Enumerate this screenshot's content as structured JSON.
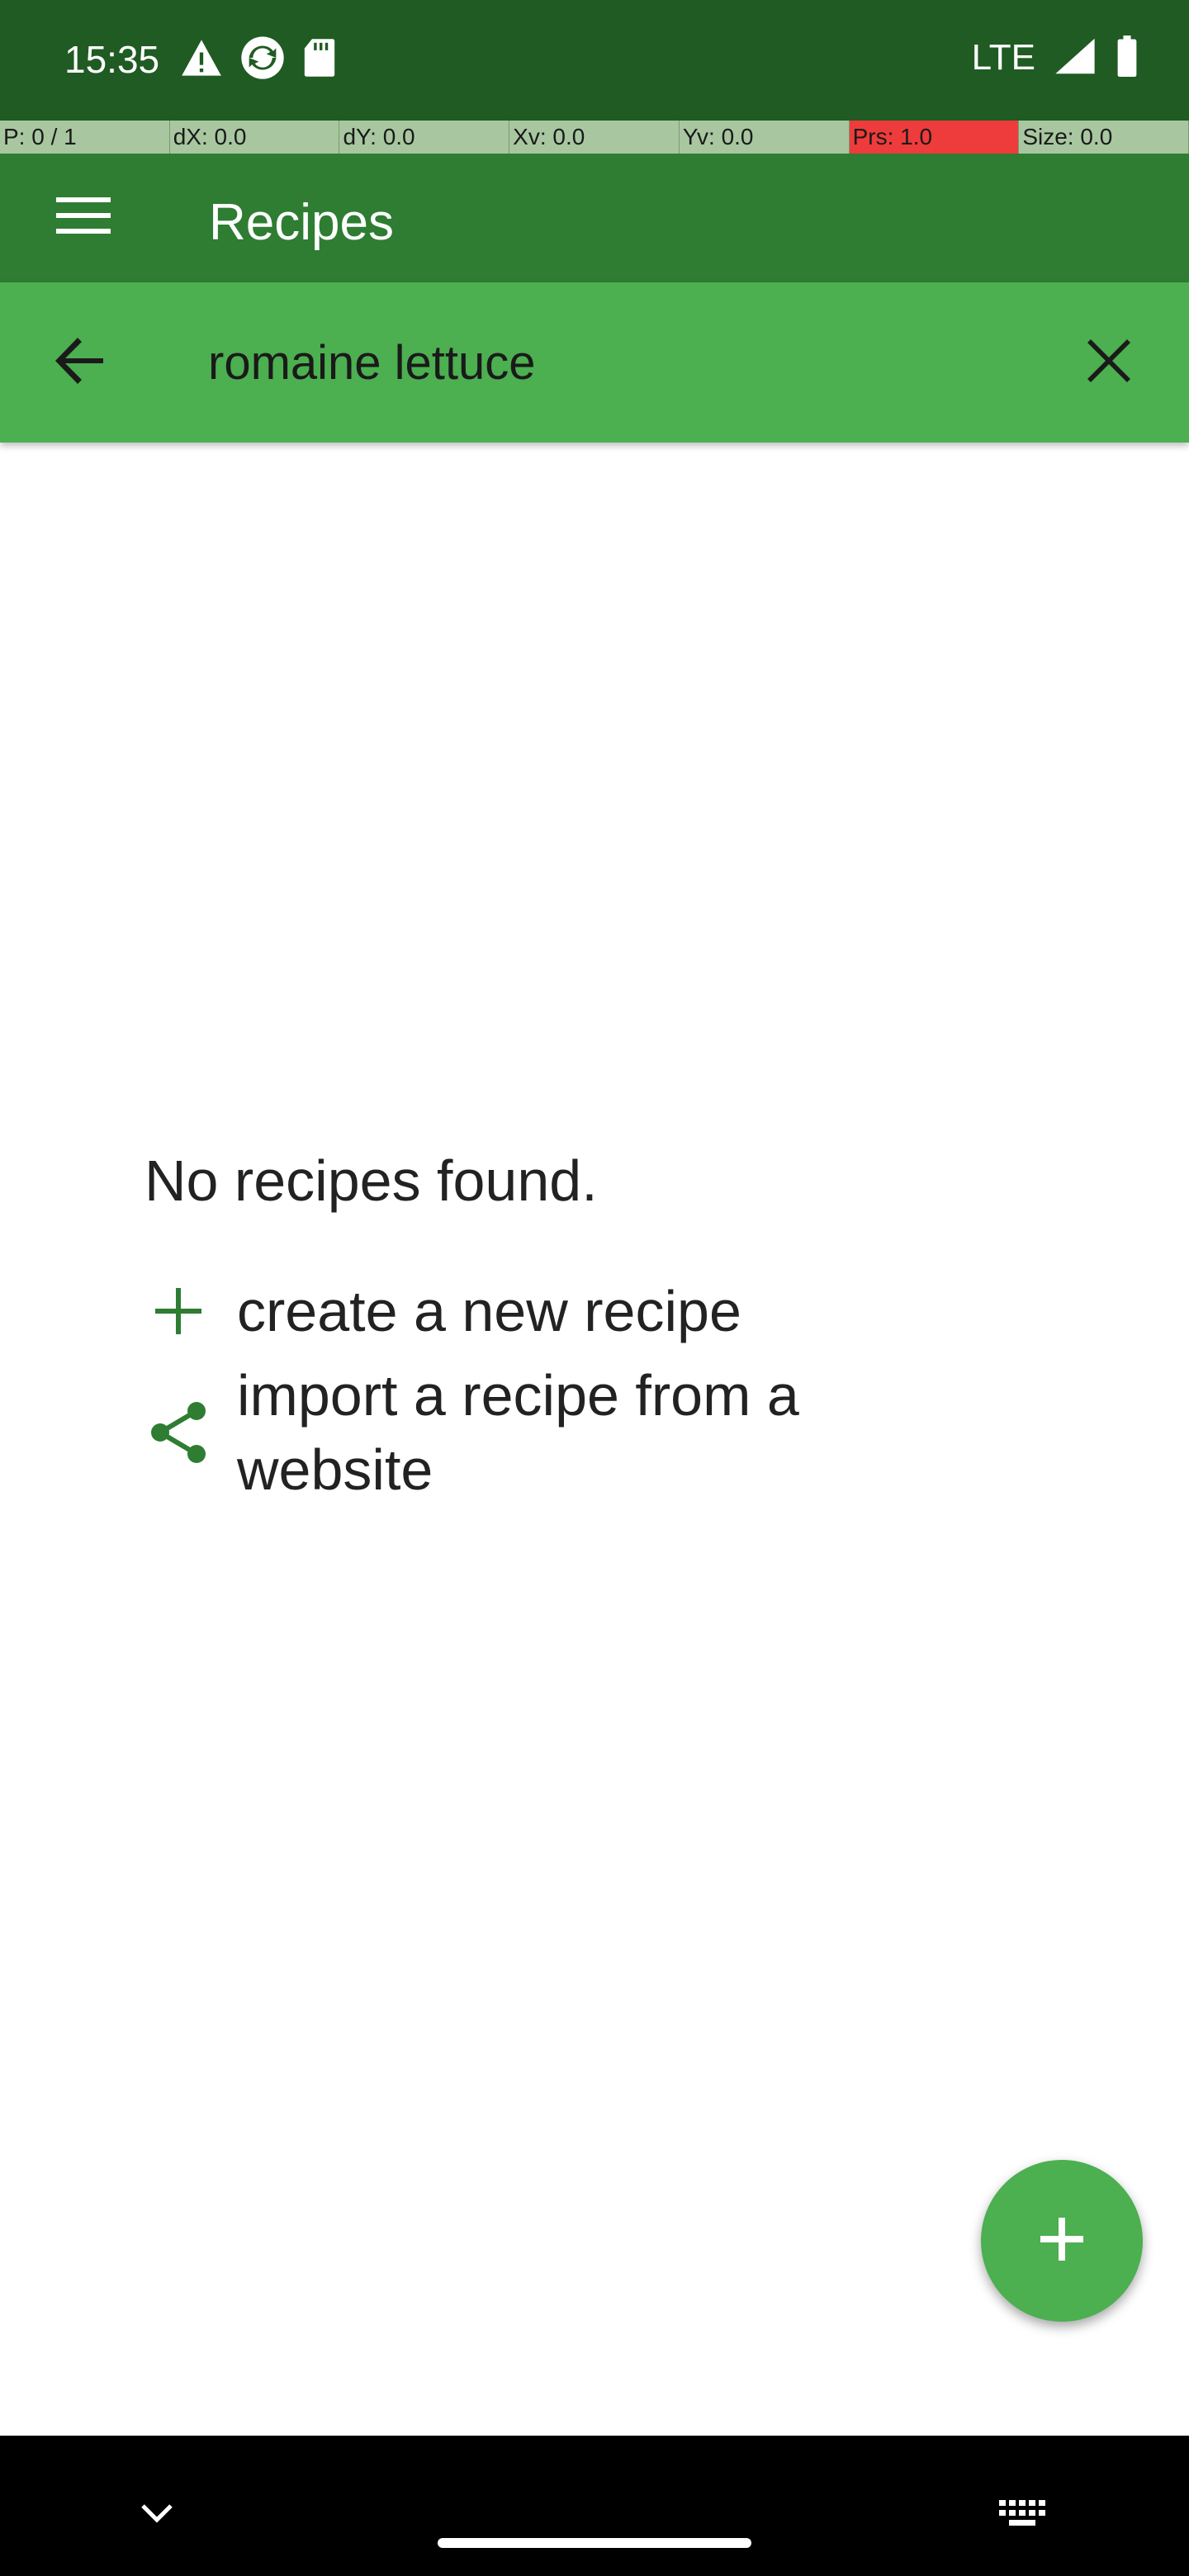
{
  "status_bar": {
    "time": "15:35",
    "network": "LTE",
    "icons": [
      "warning-icon",
      "sync-icon",
      "sd-card-icon",
      "signal-icon",
      "battery-icon"
    ]
  },
  "debug_bar": {
    "cells": [
      "P: 0 / 1",
      "dX: 0.0",
      "dY: 0.0",
      "Xv: 0.0",
      "Yv: 0.0",
      "Prs: 1.0",
      "Size: 0.0"
    ]
  },
  "app_bar": {
    "title": "Recipes",
    "menu_icon": "hamburger-menu-icon"
  },
  "search": {
    "value": "romaine lettuce",
    "back_icon": "arrow-back-icon",
    "clear_icon": "close-icon"
  },
  "empty_state": {
    "title": "No recipes found.",
    "create_label": "create a new recipe",
    "import_label": "import a recipe from a website"
  },
  "fab": {
    "icon": "plus-icon"
  },
  "nav_bar": {
    "icons": [
      "chevron-down-icon",
      "keyboard-icon"
    ]
  },
  "colors": {
    "status_bar": "#1f5b22",
    "app_bar": "#2e7d32",
    "search_bar": "#4caf50",
    "accent": "#2e7d32",
    "fab": "#4caf50"
  }
}
